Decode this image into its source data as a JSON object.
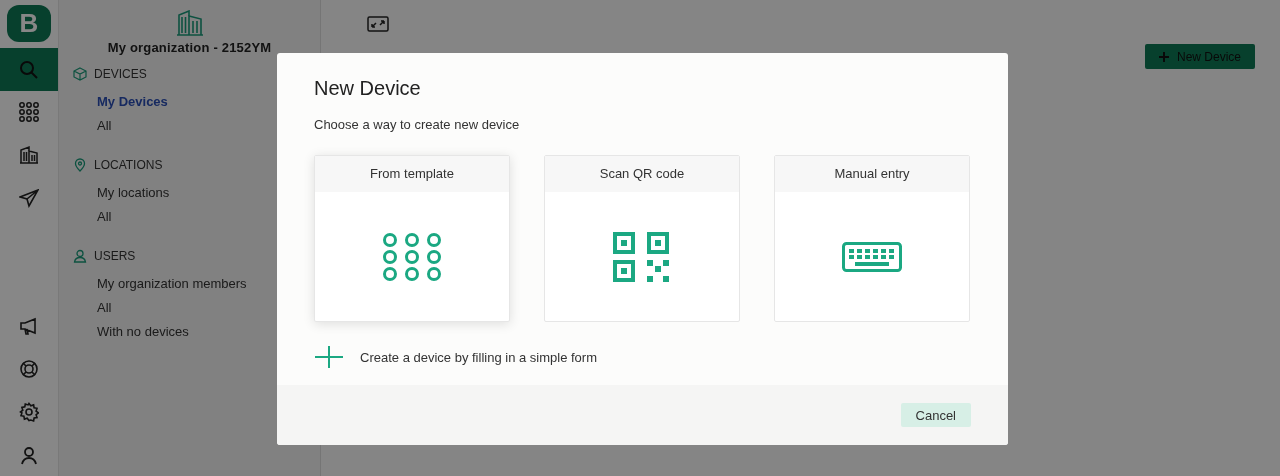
{
  "rail": {
    "logo": "B",
    "items": [
      {
        "kind": "search",
        "selected": true
      },
      {
        "kind": "grid",
        "selected": false
      },
      {
        "kind": "building",
        "selected": false
      },
      {
        "kind": "plane",
        "selected": false
      },
      {
        "kind": "megaphone",
        "selected": false
      },
      {
        "kind": "lifebuoy",
        "selected": false
      },
      {
        "kind": "gear",
        "selected": false
      },
      {
        "kind": "user",
        "selected": false
      }
    ]
  },
  "sidebar": {
    "organization": "My organization - 2152YM",
    "sections": [
      {
        "kind": "devices",
        "title": "DEVICES",
        "items": [
          {
            "label": "My Devices",
            "selected": true
          },
          {
            "label": "All",
            "selected": false
          }
        ]
      },
      {
        "kind": "locations",
        "title": "LOCATIONS",
        "items": [
          {
            "label": "My locations",
            "selected": false
          },
          {
            "label": "All",
            "selected": false
          }
        ]
      },
      {
        "kind": "users",
        "title": "USERS",
        "items": [
          {
            "label": "My organization members",
            "selected": false
          },
          {
            "label": "All",
            "selected": false
          },
          {
            "label": "With no devices",
            "selected": false
          }
        ]
      }
    ]
  },
  "page": {
    "new_button": "New Device"
  },
  "dialog": {
    "title": "New Device",
    "subtitle": "Choose a way to create new device",
    "options": [
      {
        "kind": "template",
        "label": "From template",
        "selected": true
      },
      {
        "kind": "qr",
        "label": "Scan QR code",
        "selected": false
      },
      {
        "kind": "keyboard",
        "label": "Manual entry",
        "selected": false
      }
    ],
    "form_link": "Create a device by filling in a simple form",
    "cancel": "Cancel"
  }
}
